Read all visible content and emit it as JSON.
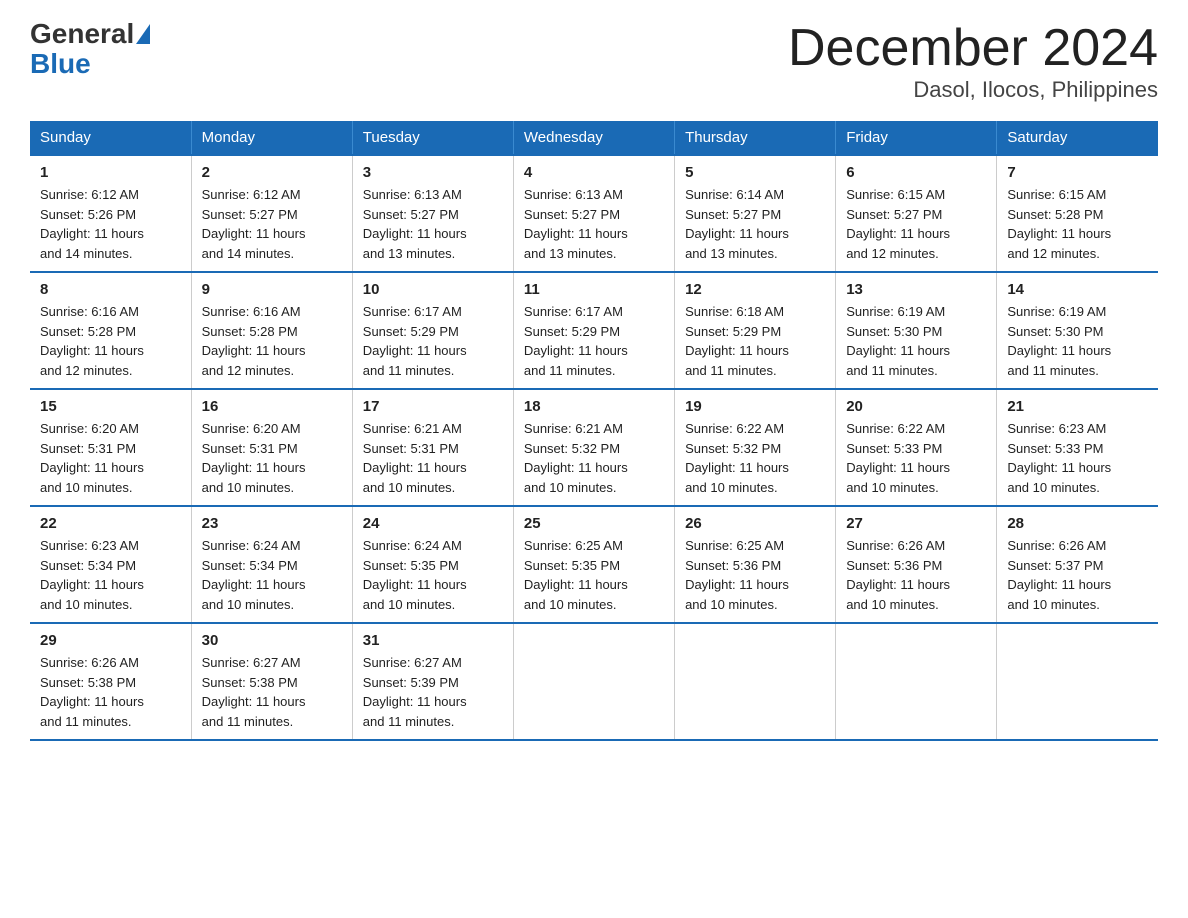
{
  "logo": {
    "general": "General",
    "blue": "Blue"
  },
  "title": "December 2024",
  "location": "Dasol, Ilocos, Philippines",
  "days_of_week": [
    "Sunday",
    "Monday",
    "Tuesday",
    "Wednesday",
    "Thursday",
    "Friday",
    "Saturday"
  ],
  "weeks": [
    [
      {
        "day": 1,
        "sunrise": "6:12 AM",
        "sunset": "5:26 PM",
        "daylight": "11 hours and 14 minutes."
      },
      {
        "day": 2,
        "sunrise": "6:12 AM",
        "sunset": "5:27 PM",
        "daylight": "11 hours and 14 minutes."
      },
      {
        "day": 3,
        "sunrise": "6:13 AM",
        "sunset": "5:27 PM",
        "daylight": "11 hours and 13 minutes."
      },
      {
        "day": 4,
        "sunrise": "6:13 AM",
        "sunset": "5:27 PM",
        "daylight": "11 hours and 13 minutes."
      },
      {
        "day": 5,
        "sunrise": "6:14 AM",
        "sunset": "5:27 PM",
        "daylight": "11 hours and 13 minutes."
      },
      {
        "day": 6,
        "sunrise": "6:15 AM",
        "sunset": "5:27 PM",
        "daylight": "11 hours and 12 minutes."
      },
      {
        "day": 7,
        "sunrise": "6:15 AM",
        "sunset": "5:28 PM",
        "daylight": "11 hours and 12 minutes."
      }
    ],
    [
      {
        "day": 8,
        "sunrise": "6:16 AM",
        "sunset": "5:28 PM",
        "daylight": "11 hours and 12 minutes."
      },
      {
        "day": 9,
        "sunrise": "6:16 AM",
        "sunset": "5:28 PM",
        "daylight": "11 hours and 12 minutes."
      },
      {
        "day": 10,
        "sunrise": "6:17 AM",
        "sunset": "5:29 PM",
        "daylight": "11 hours and 11 minutes."
      },
      {
        "day": 11,
        "sunrise": "6:17 AM",
        "sunset": "5:29 PM",
        "daylight": "11 hours and 11 minutes."
      },
      {
        "day": 12,
        "sunrise": "6:18 AM",
        "sunset": "5:29 PM",
        "daylight": "11 hours and 11 minutes."
      },
      {
        "day": 13,
        "sunrise": "6:19 AM",
        "sunset": "5:30 PM",
        "daylight": "11 hours and 11 minutes."
      },
      {
        "day": 14,
        "sunrise": "6:19 AM",
        "sunset": "5:30 PM",
        "daylight": "11 hours and 11 minutes."
      }
    ],
    [
      {
        "day": 15,
        "sunrise": "6:20 AM",
        "sunset": "5:31 PM",
        "daylight": "11 hours and 10 minutes."
      },
      {
        "day": 16,
        "sunrise": "6:20 AM",
        "sunset": "5:31 PM",
        "daylight": "11 hours and 10 minutes."
      },
      {
        "day": 17,
        "sunrise": "6:21 AM",
        "sunset": "5:31 PM",
        "daylight": "11 hours and 10 minutes."
      },
      {
        "day": 18,
        "sunrise": "6:21 AM",
        "sunset": "5:32 PM",
        "daylight": "11 hours and 10 minutes."
      },
      {
        "day": 19,
        "sunrise": "6:22 AM",
        "sunset": "5:32 PM",
        "daylight": "11 hours and 10 minutes."
      },
      {
        "day": 20,
        "sunrise": "6:22 AM",
        "sunset": "5:33 PM",
        "daylight": "11 hours and 10 minutes."
      },
      {
        "day": 21,
        "sunrise": "6:23 AM",
        "sunset": "5:33 PM",
        "daylight": "11 hours and 10 minutes."
      }
    ],
    [
      {
        "day": 22,
        "sunrise": "6:23 AM",
        "sunset": "5:34 PM",
        "daylight": "11 hours and 10 minutes."
      },
      {
        "day": 23,
        "sunrise": "6:24 AM",
        "sunset": "5:34 PM",
        "daylight": "11 hours and 10 minutes."
      },
      {
        "day": 24,
        "sunrise": "6:24 AM",
        "sunset": "5:35 PM",
        "daylight": "11 hours and 10 minutes."
      },
      {
        "day": 25,
        "sunrise": "6:25 AM",
        "sunset": "5:35 PM",
        "daylight": "11 hours and 10 minutes."
      },
      {
        "day": 26,
        "sunrise": "6:25 AM",
        "sunset": "5:36 PM",
        "daylight": "11 hours and 10 minutes."
      },
      {
        "day": 27,
        "sunrise": "6:26 AM",
        "sunset": "5:36 PM",
        "daylight": "11 hours and 10 minutes."
      },
      {
        "day": 28,
        "sunrise": "6:26 AM",
        "sunset": "5:37 PM",
        "daylight": "11 hours and 10 minutes."
      }
    ],
    [
      {
        "day": 29,
        "sunrise": "6:26 AM",
        "sunset": "5:38 PM",
        "daylight": "11 hours and 11 minutes."
      },
      {
        "day": 30,
        "sunrise": "6:27 AM",
        "sunset": "5:38 PM",
        "daylight": "11 hours and 11 minutes."
      },
      {
        "day": 31,
        "sunrise": "6:27 AM",
        "sunset": "5:39 PM",
        "daylight": "11 hours and 11 minutes."
      },
      null,
      null,
      null,
      null
    ]
  ],
  "labels": {
    "sunrise": "Sunrise:",
    "sunset": "Sunset:",
    "daylight": "Daylight:"
  }
}
